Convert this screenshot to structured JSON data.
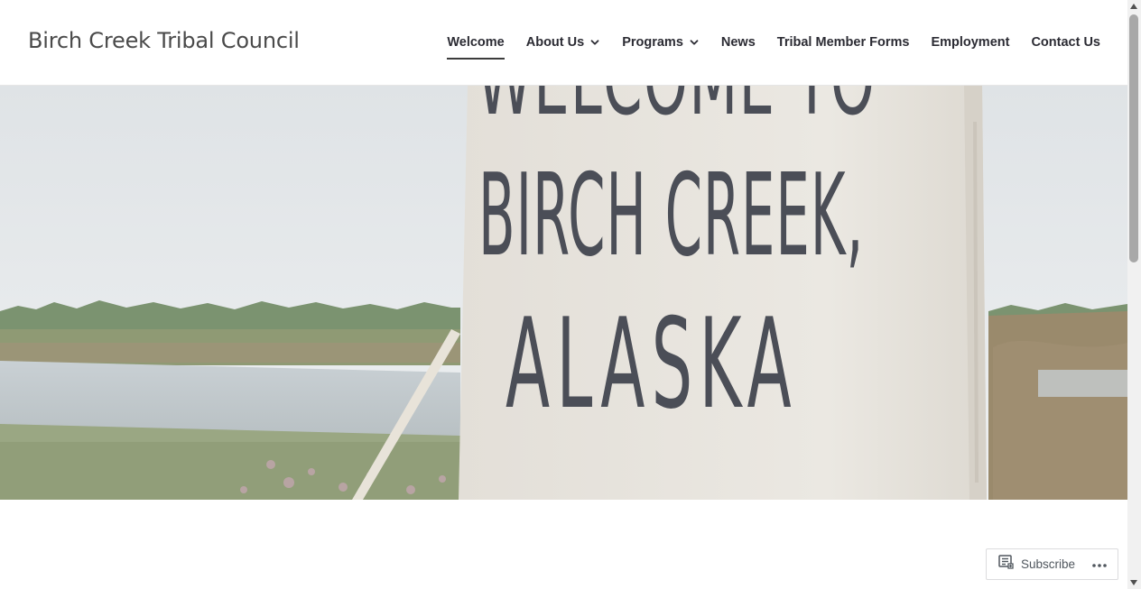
{
  "site": {
    "title": "Birch Creek Tribal Council"
  },
  "nav": {
    "items": [
      {
        "label": "Welcome",
        "active": true,
        "has_dropdown": false
      },
      {
        "label": "About Us",
        "active": false,
        "has_dropdown": true
      },
      {
        "label": "Programs",
        "active": false,
        "has_dropdown": true
      },
      {
        "label": "News",
        "active": false,
        "has_dropdown": false
      },
      {
        "label": "Tribal Member Forms",
        "active": false,
        "has_dropdown": false
      },
      {
        "label": "Employment",
        "active": false,
        "has_dropdown": false
      },
      {
        "label": "Contact Us",
        "active": false,
        "has_dropdown": false
      }
    ]
  },
  "hero": {
    "sign": {
      "line1": "WELCOME TO",
      "line2": "BIRCH CREEK,",
      "line3": "ALASKA"
    }
  },
  "subscribe_widget": {
    "subscribe_label": "Subscribe",
    "subscribe_icon": "reader-icon",
    "more_icon": "ellipsis-icon"
  },
  "colors": {
    "text_dark": "#2b2b33",
    "title": "#4a4a4a",
    "sky": "#e9ecee",
    "sign_board": "#e6e2db",
    "sign_paint": "#4b4e57"
  }
}
